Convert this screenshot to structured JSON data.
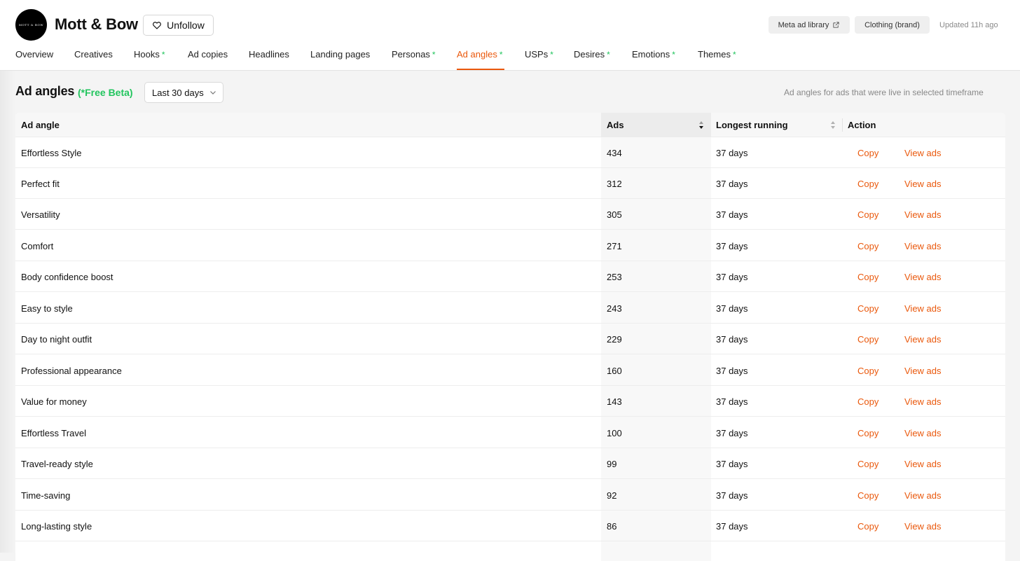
{
  "header": {
    "logo_text": "MOTT & BOW",
    "brand": "Mott & Bow",
    "follow_label": "Unfollow",
    "meta_library_label": "Meta ad library",
    "category_label": "Clothing (brand)",
    "updated": "Updated 11h ago"
  },
  "tabs": [
    {
      "label": "Overview",
      "dot": ""
    },
    {
      "label": "Creatives",
      "dot": ""
    },
    {
      "label": "Hooks",
      "dot": "*"
    },
    {
      "label": "Ad copies",
      "dot": ""
    },
    {
      "label": "Headlines",
      "dot": ""
    },
    {
      "label": "Landing pages",
      "dot": ""
    },
    {
      "label": "Personas",
      "dot": "*"
    },
    {
      "label": "Ad angles",
      "dot": "*",
      "active": true
    },
    {
      "label": "USPs",
      "dot": "*"
    },
    {
      "label": "Desires",
      "dot": "*"
    },
    {
      "label": "Emotions",
      "dot": "*"
    },
    {
      "label": "Themes",
      "dot": "*"
    }
  ],
  "section": {
    "title": "Ad angles",
    "beta": "(*Free Beta)",
    "range": "Last 30 days",
    "subtitle": "Ad angles for ads that were live in selected timeframe"
  },
  "table": {
    "columns": {
      "angle": "Ad angle",
      "ads": "Ads",
      "longest": "Longest running",
      "action": "Action"
    },
    "copy_label": "Copy",
    "view_label": "View ads",
    "rows": [
      {
        "angle": "Effortless Style",
        "ads": "434",
        "longest": "37 days"
      },
      {
        "angle": "Perfect fit",
        "ads": "312",
        "longest": "37 days"
      },
      {
        "angle": "Versatility",
        "ads": "305",
        "longest": "37 days"
      },
      {
        "angle": "Comfort",
        "ads": "271",
        "longest": "37 days"
      },
      {
        "angle": "Body confidence boost",
        "ads": "253",
        "longest": "37 days"
      },
      {
        "angle": "Easy to style",
        "ads": "243",
        "longest": "37 days"
      },
      {
        "angle": "Day to night outfit",
        "ads": "229",
        "longest": "37 days"
      },
      {
        "angle": "Professional appearance",
        "ads": "160",
        "longest": "37 days"
      },
      {
        "angle": "Value for money",
        "ads": "143",
        "longest": "37 days"
      },
      {
        "angle": "Effortless Travel",
        "ads": "100",
        "longest": "37 days"
      },
      {
        "angle": "Travel-ready style",
        "ads": "99",
        "longest": "37 days"
      },
      {
        "angle": "Time-saving",
        "ads": "92",
        "longest": "37 days"
      },
      {
        "angle": "Long-lasting style",
        "ads": "86",
        "longest": "37 days"
      }
    ]
  },
  "colors": {
    "accent": "#ea580c",
    "beta": "#22c55e"
  }
}
